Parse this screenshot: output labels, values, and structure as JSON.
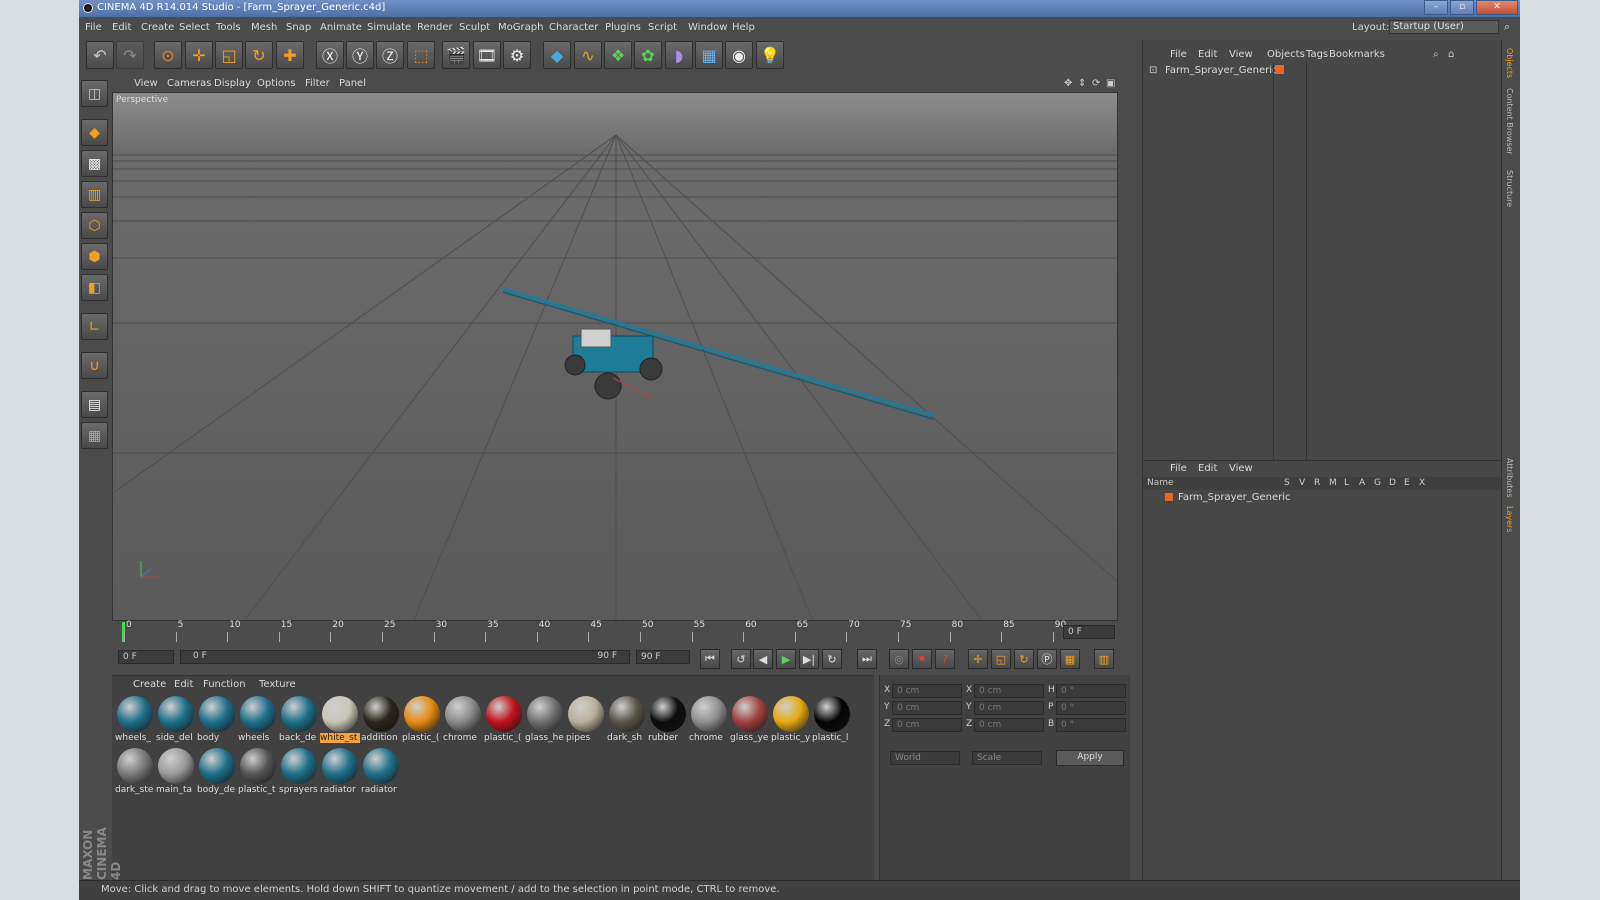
{
  "window": {
    "title": "CINEMA 4D R14.014 Studio - [Farm_Sprayer_Generic.c4d]"
  },
  "menu": [
    "File",
    "Edit",
    "Create",
    "Select",
    "Tools",
    "Mesh",
    "Snap",
    "Animate",
    "Simulate",
    "Render",
    "Sculpt",
    "MoGraph",
    "Character",
    "Plugins",
    "Script",
    "Window",
    "Help"
  ],
  "layout": {
    "label": "Layout:",
    "value": "Startup (User)"
  },
  "viewport": {
    "menu": [
      "View",
      "Cameras",
      "Display",
      "Options",
      "Filter",
      "Panel"
    ],
    "label": "Perspective"
  },
  "timeline": {
    "ticks": [
      "0",
      "5",
      "10",
      "15",
      "20",
      "25",
      "30",
      "35",
      "40",
      "45",
      "50",
      "55",
      "60",
      "65",
      "70",
      "75",
      "80",
      "85",
      "90"
    ],
    "current_frame": "0 F"
  },
  "transport": {
    "start": "0 F",
    "range_start": "0 F",
    "range_end": "90 F",
    "end": "90 F"
  },
  "materials": {
    "menu": [
      "Create",
      "Edit",
      "Function",
      "Texture"
    ],
    "items": [
      {
        "label": "wheels_",
        "color": "#1f6f8a"
      },
      {
        "label": "side_del",
        "color": "#1f6f8a"
      },
      {
        "label": "body",
        "color": "#1f6f8a"
      },
      {
        "label": "wheels",
        "color": "#1f6f8a"
      },
      {
        "label": "back_de",
        "color": "#1f6f8a"
      },
      {
        "label": "white_st",
        "color": "#c9c6b8"
      },
      {
        "label": "addition",
        "color": "#2a241c"
      },
      {
        "label": "plastic_(",
        "color": "#e88a12"
      },
      {
        "label": "chrome",
        "color": "#8a8a8a"
      },
      {
        "label": "plastic_(",
        "color": "#c0111b"
      },
      {
        "label": "glass_he",
        "color": "#707070"
      },
      {
        "label": "pipes",
        "color": "#b9b09c"
      },
      {
        "label": "dark_sh",
        "color": "#5a554a"
      },
      {
        "label": "rubber",
        "color": "#0d0d0d"
      },
      {
        "label": "chrome",
        "color": "#8f8f8f"
      },
      {
        "label": "glass_ye",
        "color": "#a04040"
      },
      {
        "label": "plastic_y",
        "color": "#e6a90f"
      },
      {
        "label": "plastic_l",
        "color": "#050505"
      },
      {
        "label": "dark_ste",
        "color": "#7a7a7a"
      },
      {
        "label": "main_ta",
        "color": "#9a9a9a"
      },
      {
        "label": "body_de",
        "color": "#1f6f8a"
      },
      {
        "label": "plastic_t",
        "color": "#555555"
      },
      {
        "label": "sprayers",
        "color": "#1f6f8a"
      },
      {
        "label": "radiator",
        "color": "#1f6f8a"
      },
      {
        "label": "radiator",
        "color": "#1f6f8a"
      }
    ],
    "selected_index": 5
  },
  "attributes": {
    "fields": [
      {
        "axis": "X",
        "value": "0 cm"
      },
      {
        "axis": "X",
        "value": "0 cm"
      },
      {
        "axis": "H",
        "value": "0 °"
      },
      {
        "axis": "Y",
        "value": "0 cm"
      },
      {
        "axis": "Y",
        "value": "0 cm"
      },
      {
        "axis": "P",
        "value": "0 °"
      },
      {
        "axis": "Z",
        "value": "0 cm"
      },
      {
        "axis": "Z",
        "value": "0 cm"
      },
      {
        "axis": "B",
        "value": "0 °"
      }
    ],
    "coord_system": "World",
    "mode": "Scale",
    "apply": "Apply"
  },
  "objects": {
    "menu": [
      "File",
      "Edit",
      "View",
      "Objects",
      "Tags",
      "Bookmarks"
    ],
    "items": [
      {
        "name": "Farm_Sprayer_Generic"
      }
    ]
  },
  "layers": {
    "menu": [
      "File",
      "Edit",
      "View"
    ],
    "header": {
      "name": "Name",
      "cols": [
        "S",
        "V",
        "R",
        "M",
        "L",
        "A",
        "G",
        "D",
        "E",
        "X"
      ]
    },
    "items": [
      {
        "name": "Farm_Sprayer_Generic"
      }
    ]
  },
  "right_tabs": [
    "Objects",
    "Content Browser",
    "Structure",
    "Attributes",
    "Layers"
  ],
  "brand": "MAXON CINEMA 4D",
  "status": "Move: Click and drag to move elements. Hold down SHIFT to quantize movement / add to the selection in point mode, CTRL to remove.",
  "colors": {
    "accent": "#f2a53a",
    "model": "#1e7c98",
    "timeline_marker": "#3fdc52"
  }
}
